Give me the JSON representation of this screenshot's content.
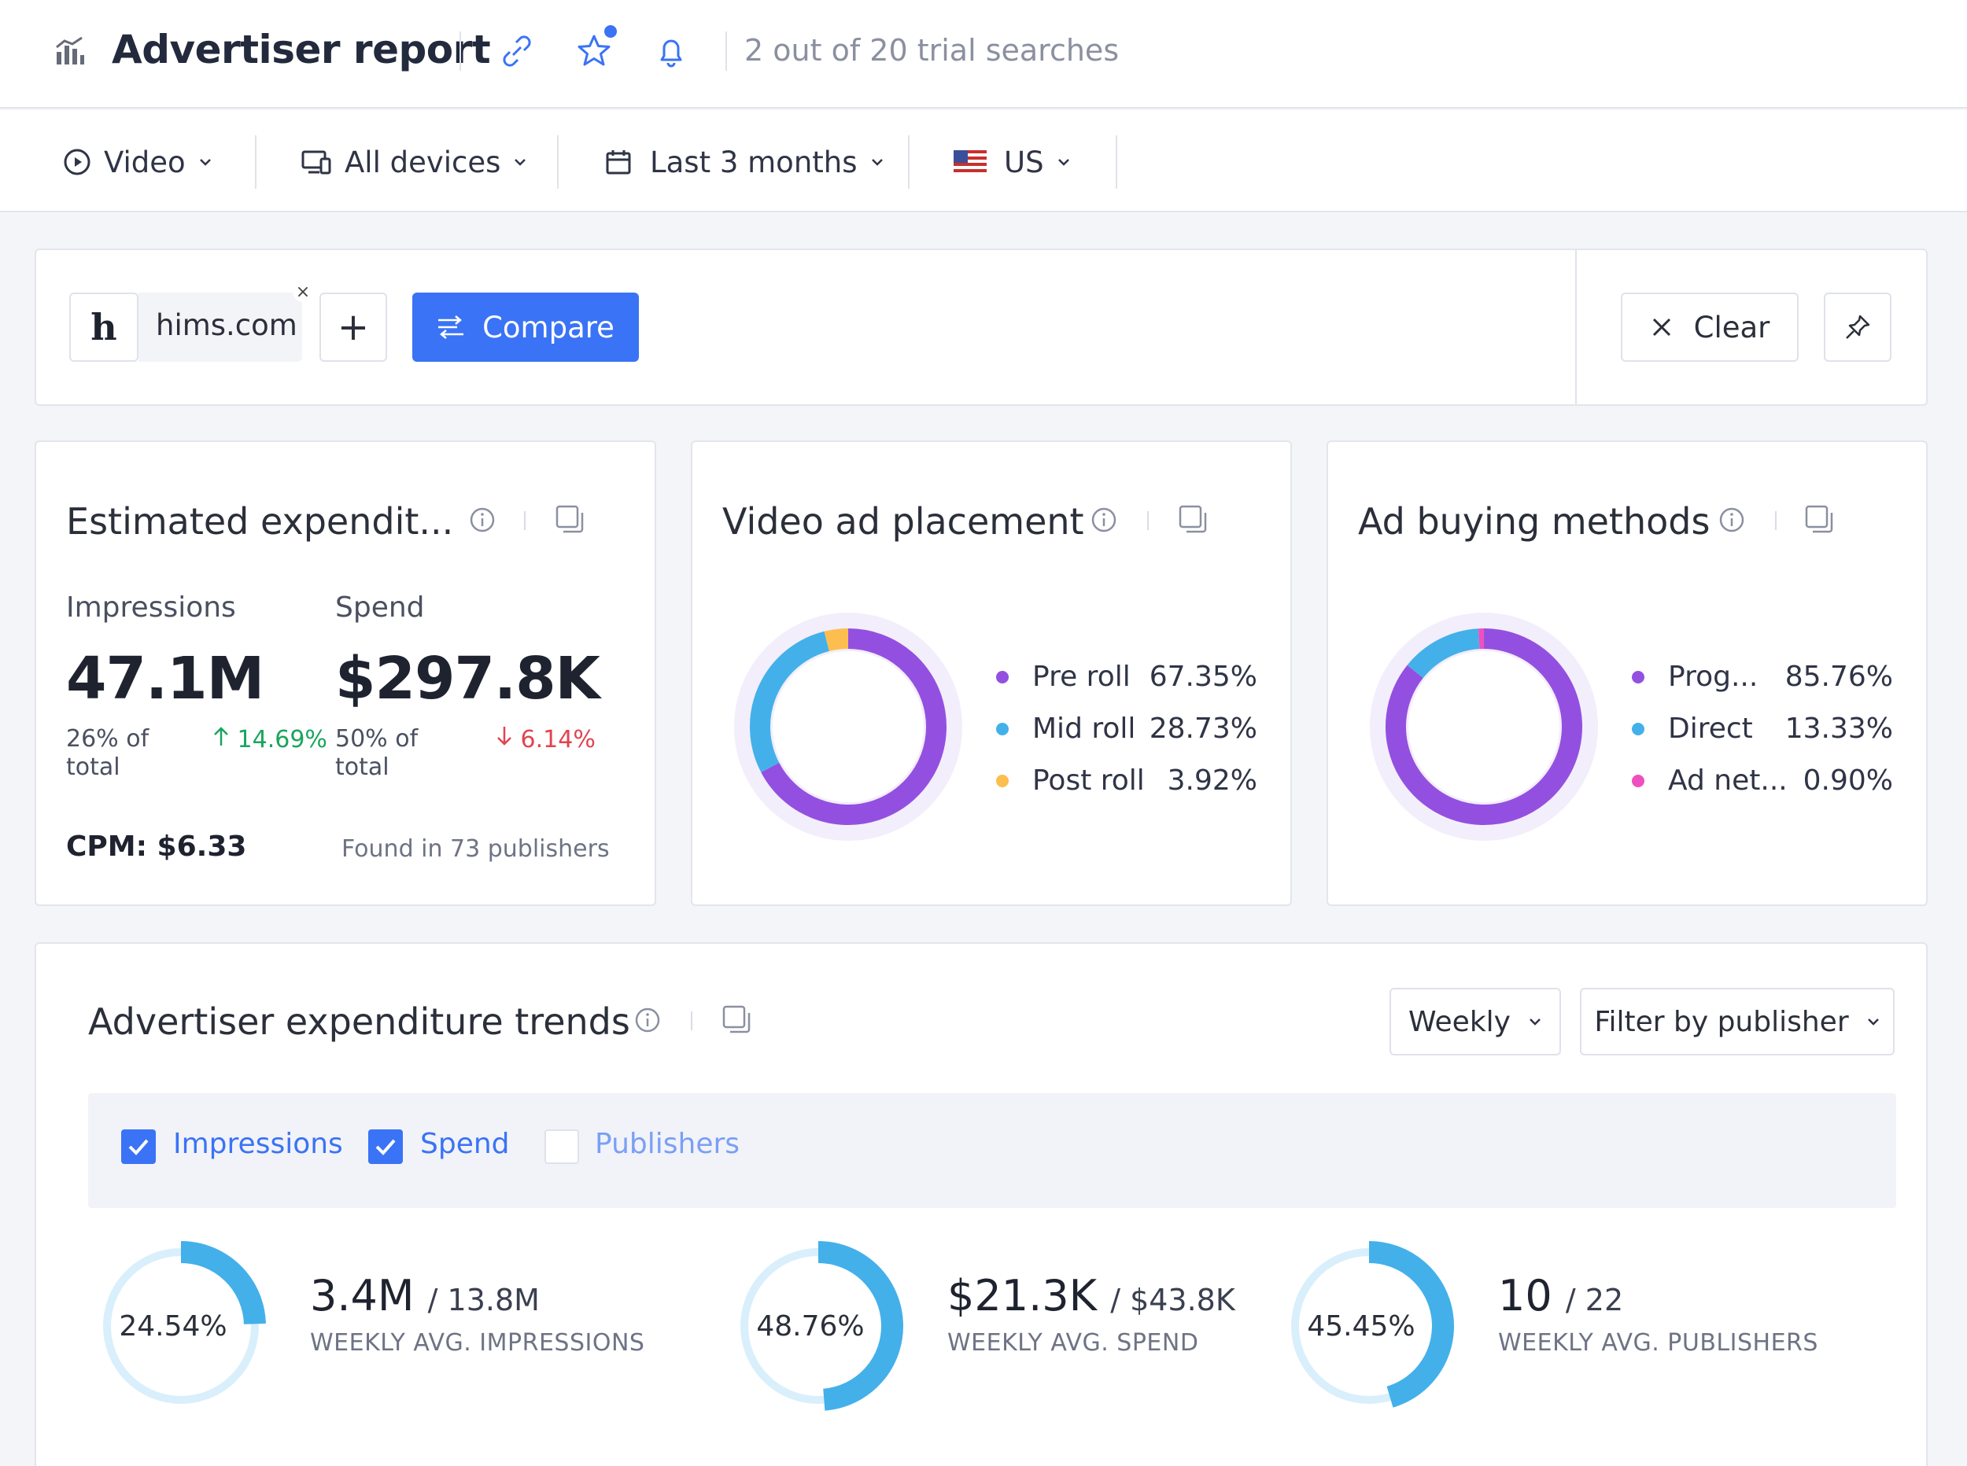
{
  "header": {
    "title": "Advertiser report",
    "icons": [
      "report-icon",
      "link-icon",
      "star-icon",
      "bell-icon"
    ],
    "trial_text": "2 out of 20 trial searches"
  },
  "filters": {
    "type": "Video",
    "devices": "All devices",
    "period": "Last 3 months",
    "country": "US"
  },
  "search": {
    "logo_letter": "h",
    "domain": "hims.com",
    "remove": "×",
    "add": "+",
    "compare_label": "Compare",
    "clear_label": "Clear"
  },
  "expenditure": {
    "title": "Estimated expendit...",
    "impressions_label": "Impressions",
    "impressions_value": "47.1M",
    "impressions_share_line1": "26% of",
    "impressions_share_line2": "total",
    "impressions_change": "14.69%",
    "spend_label": "Spend",
    "spend_value": "$297.8K",
    "spend_share_line1": "50% of",
    "spend_share_line2": "total",
    "spend_change": "6.14%",
    "cpm": "CPM: $6.33",
    "found": "Found in 73 publishers"
  },
  "placement": {
    "title": "Video ad placement",
    "items": [
      {
        "name": "Pre roll",
        "value": "67.35%",
        "pct": 67.35,
        "color": "#9350e0"
      },
      {
        "name": "Mid roll",
        "value": "28.73%",
        "pct": 28.73,
        "color": "#43b0ea"
      },
      {
        "name": "Post roll",
        "value": "3.92%",
        "pct": 3.92,
        "color": "#fcbe4e"
      }
    ]
  },
  "buying": {
    "title": "Ad buying methods",
    "items": [
      {
        "name": "Prog...",
        "value": "85.76%",
        "pct": 85.76,
        "color": "#9350e0"
      },
      {
        "name": "Direct",
        "value": "13.33%",
        "pct": 13.33,
        "color": "#43b0ea"
      },
      {
        "name": "Ad net...",
        "value": "0.90%",
        "pct": 0.9,
        "color": "#f04fc0"
      }
    ]
  },
  "trends": {
    "title": "Advertiser expenditure trends",
    "frequency": "Weekly",
    "filter_label": "Filter by publisher",
    "checkboxes": {
      "impressions": "Impressions",
      "spend": "Spend",
      "publishers": "Publishers"
    },
    "kpis": [
      {
        "pct_label": "24.54%",
        "pct": 24.54,
        "value": "3.4M",
        "total": "/ 13.8M",
        "label": "WEEKLY AVG. IMPRESSIONS"
      },
      {
        "pct_label": "48.76%",
        "pct": 48.76,
        "value": "$21.3K",
        "total": "/ $43.8K",
        "label": "WEEKLY AVG. SPEND"
      },
      {
        "pct_label": "45.45%",
        "pct": 45.45,
        "value": "10",
        "total": "/ 22",
        "label": "WEEKLY AVG. PUBLISHERS"
      }
    ]
  }
}
